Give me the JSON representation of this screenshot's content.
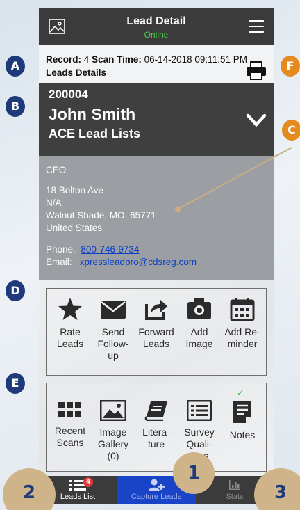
{
  "header": {
    "title": "Lead Detail",
    "status": "Online",
    "status_color": "#4fd14a"
  },
  "record": {
    "record_label": "Record:",
    "record_value": "4",
    "scan_label": "Scan Time:",
    "scan_value": "06-14-2018 09:11:51 PM",
    "section_title": "Leads Details"
  },
  "lead": {
    "id": "200004",
    "name": "John Smith",
    "list_name": "ACE Lead Lists",
    "title": "CEO",
    "address1": "18 Bolton Ave",
    "address2": "N/A",
    "city_line": "Walnut Shade, MO, 65771",
    "country": "United States",
    "phone_label": "Phone:",
    "phone": "800-746-9734",
    "email_label": "Email:",
    "email": "xpressleadpro@cdsreg.com"
  },
  "actions": [
    {
      "label": "Rate Leads",
      "icon": "star-icon"
    },
    {
      "label": "Send Follow-up",
      "icon": "envelope-icon"
    },
    {
      "label": "Forward Leads",
      "icon": "share-icon"
    },
    {
      "label": "Add Image",
      "icon": "camera-icon"
    },
    {
      "label": "Add Re-minder",
      "icon": "calendar-icon"
    }
  ],
  "tools": [
    {
      "label": "Recent Scans",
      "icon": "grid-icon"
    },
    {
      "label": "Image Gallery (0)",
      "icon": "image-icon"
    },
    {
      "label": "Litera-ture",
      "icon": "book-icon"
    },
    {
      "label": "Survey Quali-fiers",
      "icon": "list-icon"
    },
    {
      "label": "Notes",
      "icon": "note-icon",
      "checked": true
    }
  ],
  "nav": {
    "leads_list": "Leads List",
    "leads_badge": "4",
    "capture": "Capture Leads",
    "stats": "Stats"
  },
  "markers": {
    "a": "A",
    "b": "B",
    "c": "C",
    "d": "D",
    "e": "E",
    "f": "F",
    "one": "1",
    "two": "2",
    "three": "3"
  },
  "colors": {
    "accent": "#1a44c8",
    "dark": "#3b3b3b",
    "marker_blue": "#1f3a7a",
    "marker_orange": "#e58a1e"
  }
}
